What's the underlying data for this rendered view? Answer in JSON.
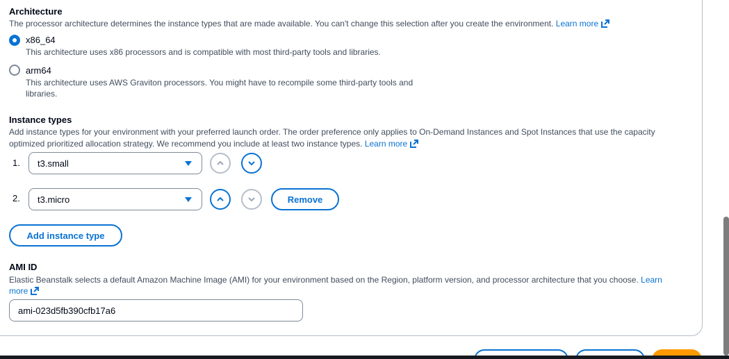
{
  "architecture": {
    "title": "Architecture",
    "description": "The processor architecture determines the instance types that are made available. You can't change this selection after you create the environment.",
    "learn_more": "Learn more",
    "options": [
      {
        "label": "x86_64",
        "description": "This architecture uses x86 processors and is compatible with most third-party tools and libraries.",
        "checked": true
      },
      {
        "label": "arm64",
        "description_line1": "This architecture uses AWS Graviton processors. You might have to recompile some third-party tools and",
        "description_line2": "libraries.",
        "checked": false
      }
    ]
  },
  "instance_types": {
    "title": "Instance types",
    "description_line1": "Add instance types for your environment with your preferred launch order. The order preference only applies to On-Demand Instances and Spot Instances that use the capacity",
    "description_line2": "optimized prioritized allocation strategy. We recommend you include at least two instance types.",
    "learn_more": "Learn more",
    "rows": [
      {
        "num": "1.",
        "value": "t3.small"
      },
      {
        "num": "2.",
        "value": "t3.micro",
        "remove_label": "Remove"
      }
    ],
    "add_label": "Add instance type"
  },
  "ami": {
    "title": "AMI ID",
    "description": "Elastic Beanstalk selects a default Amazon Machine Image (AMI) for your environment based on the Region, platform version, and processor architecture that you choose.",
    "learn": "Learn",
    "more": "more",
    "value": "ami-023d5fb390cfb17a6"
  },
  "colors": {
    "accent": "#0972d3",
    "primary_button": "#ff9900"
  }
}
